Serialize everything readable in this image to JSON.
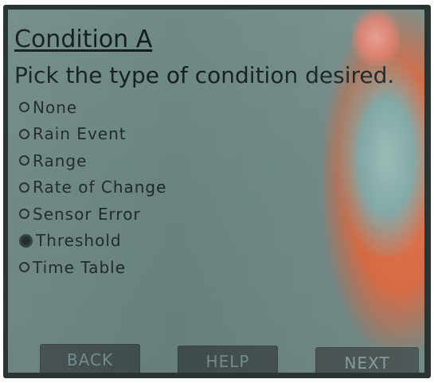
{
  "screen": {
    "title": "Condition A",
    "prompt": "Pick the type of condition desired."
  },
  "options": [
    {
      "label": "None",
      "selected": false
    },
    {
      "label": "Rain Event",
      "selected": false
    },
    {
      "label": "Range",
      "selected": false
    },
    {
      "label": "Rate of Change",
      "selected": false
    },
    {
      "label": "Sensor Error",
      "selected": false
    },
    {
      "label": "Threshold",
      "selected": true
    },
    {
      "label": "Time Table",
      "selected": false
    }
  ],
  "softkeys": {
    "back": "BACK",
    "help": "HELP",
    "next": "NEXT"
  },
  "colors": {
    "screen_background": "#6c8785",
    "text": "#131e21",
    "softkey_background": "#3f4b4a",
    "softkey_text": "#6d8a89"
  }
}
